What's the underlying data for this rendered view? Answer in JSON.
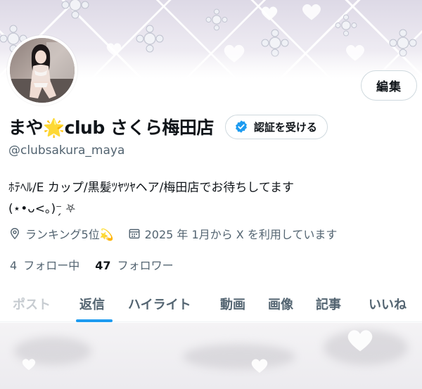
{
  "profile": {
    "display_name": "まや🌟club さくら梅田店",
    "handle": "@clubsakura_maya",
    "bio_lines": [
      "ﾎﾃﾍﾙ/E カップ/黒髪ﾂﾔﾂﾔヘア/梅田店でお待ちしてます",
      "(⋆•ᴗ<｡)⁻̗ ⛧"
    ],
    "location": "ランキング5位💫",
    "joined": "2025 年 1月から X を利用しています",
    "following_count": "4",
    "following_label": "フォロー中",
    "followers_count": "47",
    "followers_label": "フォロワー"
  },
  "buttons": {
    "edit_label": "編集",
    "verify_label": "認証を受ける"
  },
  "tabs": [
    {
      "label": "ポスト",
      "active": false
    },
    {
      "label": "返信",
      "active": true
    },
    {
      "label": "ハイライト",
      "active": false
    },
    {
      "label": "動画",
      "active": false
    },
    {
      "label": "画像",
      "active": false
    },
    {
      "label": "記事",
      "active": false
    },
    {
      "label": "いいね",
      "active": false
    }
  ],
  "icons": {
    "verify": "verified-badge-icon",
    "location": "location-pin-icon",
    "calendar": "calendar-icon"
  },
  "colors": {
    "accent": "#1d9bf0",
    "text_primary": "#0f1419",
    "text_secondary": "#536471",
    "border": "#cfd9de"
  }
}
